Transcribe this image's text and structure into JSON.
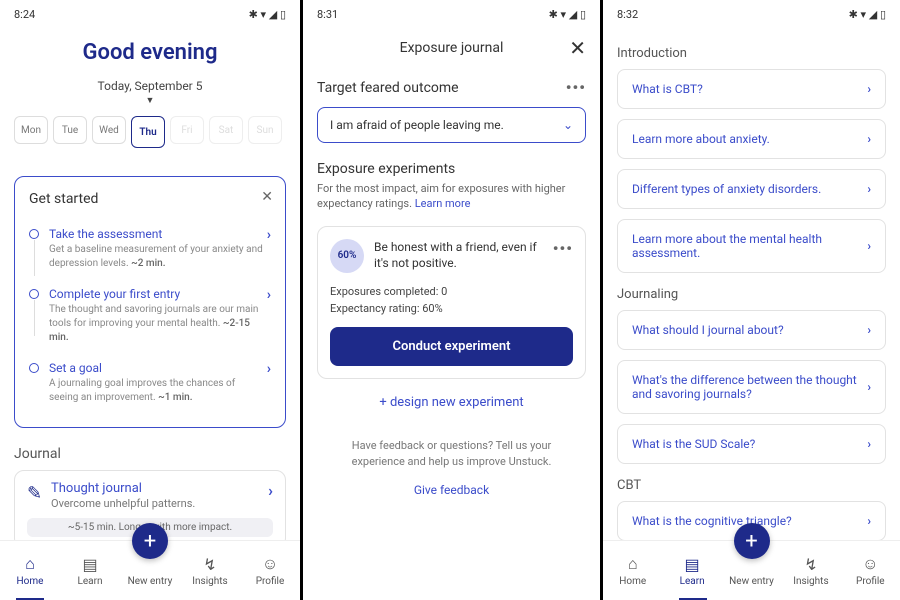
{
  "screens": [
    {
      "status": {
        "time": "8:24"
      },
      "greeting": "Good evening",
      "date": "Today, September 5",
      "days": [
        "Mon",
        "Tue",
        "Wed",
        "Thu",
        "Fri",
        "Sat",
        "Sun"
      ],
      "selected_day_index": 3,
      "get_started": {
        "title": "Get started",
        "items": [
          {
            "title": "Take the assessment",
            "desc": "Get a baseline measurement of your anxiety and depression levels.",
            "time": "~2 min."
          },
          {
            "title": "Complete your first entry",
            "desc": "The thought and savoring journals are our main tools for improving your mental health.",
            "time": "~2-15 min."
          },
          {
            "title": "Set a goal",
            "desc": "A journaling goal improves the chances of seeing an improvement.",
            "time": "~1 min."
          }
        ]
      },
      "journal": {
        "section": "Journal",
        "title": "Thought journal",
        "sub": "Overcome unhelpful patterns.",
        "meta": "~5-15 min. Longer with more impact."
      },
      "nav_active": 0
    },
    {
      "status": {
        "time": "8:31"
      },
      "modal_title": "Exposure journal",
      "target": {
        "label": "Target feared outcome",
        "value": "I am afraid of people leaving me."
      },
      "experiments": {
        "label": "Exposure experiments",
        "desc": "For the most impact, aim for exposures with higher expectancy ratings.",
        "learn_more": "Learn more"
      },
      "experiment": {
        "badge": "60%",
        "title": "Be honest with a friend, even if it's not positive.",
        "completed_label": "Exposures completed:",
        "completed_value": "0",
        "rating_label": "Expectancy rating:",
        "rating_value": "60%",
        "button": "Conduct experiment"
      },
      "design_link": "+ design new experiment",
      "feedback_text": "Have feedback or questions? Tell us your experience and help us improve Unstuck.",
      "feedback_link": "Give feedback"
    },
    {
      "status": {
        "time": "8:32"
      },
      "sections": [
        {
          "label": "Introduction",
          "items": [
            "What is CBT?",
            "Learn more about anxiety.",
            "Different types of anxiety disorders.",
            "Learn more about the mental health assessment."
          ]
        },
        {
          "label": "Journaling",
          "items": [
            "What should I journal about?",
            "What's the difference between the thought and savoring journals?",
            "What is the SUD Scale?"
          ]
        },
        {
          "label": "CBT",
          "items": [
            "What is the cognitive triangle?"
          ]
        }
      ],
      "nav_active": 1
    }
  ],
  "nav": {
    "items": [
      "Home",
      "Learn",
      "New entry",
      "Insights",
      "Profile"
    ]
  }
}
